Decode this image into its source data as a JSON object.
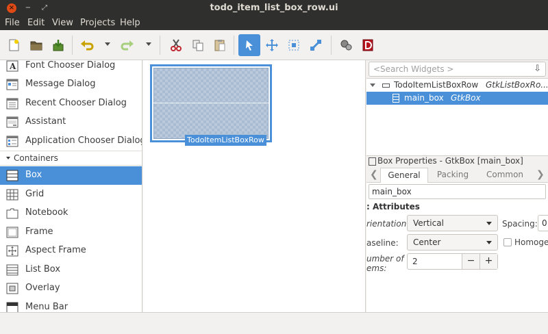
{
  "window": {
    "title": "todo_item_list_box_row.ui",
    "close_glyph": "×",
    "min_glyph": "−",
    "max_glyph": "⤢"
  },
  "menu": [
    "File",
    "Edit",
    "View",
    "Projects",
    "Help"
  ],
  "toolbar": {
    "icons": [
      "new-icon",
      "open-icon",
      "save-icon",
      "undo-icon",
      "redo-icon",
      "cut-icon",
      "copy-icon",
      "paste-icon",
      "select-icon",
      "drag-resize-icon",
      "margin-edit-icon",
      "align-edit-icon",
      "inspector-icon",
      "devhelp-icon"
    ],
    "active": "select-icon"
  },
  "palette": {
    "items_above": [
      {
        "label": "Font Chooser Dialog",
        "icon": "font-chooser-icon"
      },
      {
        "label": "Message Dialog",
        "icon": "message-dialog-icon"
      },
      {
        "label": "Recent Chooser Dialog",
        "icon": "recent-chooser-icon"
      },
      {
        "label": "Assistant",
        "icon": "assistant-icon"
      },
      {
        "label": "Application Chooser Dialog",
        "icon": "app-chooser-icon"
      }
    ],
    "section": "Containers",
    "items_below": [
      {
        "label": "Box",
        "icon": "box-icon",
        "selected": true
      },
      {
        "label": "Grid",
        "icon": "grid-icon"
      },
      {
        "label": "Notebook",
        "icon": "notebook-icon"
      },
      {
        "label": "Frame",
        "icon": "frame-icon"
      },
      {
        "label": "Aspect Frame",
        "icon": "aspect-frame-icon"
      },
      {
        "label": "List Box",
        "icon": "list-box-icon"
      },
      {
        "label": "Overlay",
        "icon": "overlay-icon"
      },
      {
        "label": "Menu Bar",
        "icon": "menu-bar-icon"
      }
    ]
  },
  "canvas": {
    "widget_label": "TodoItemListBoxRow"
  },
  "inspector": {
    "search_placeholder": "<Search Widgets >",
    "search_action_glyph": "⇩",
    "tree": [
      {
        "name": "TodoItemListBoxRow",
        "class": "GtkListBoxRo...",
        "selected": false
      },
      {
        "name": "main_box",
        "class": "GtkBox",
        "selected": true
      }
    ]
  },
  "properties": {
    "title": "Box Properties - GtkBox [main_box]",
    "tabs": [
      "General",
      "Packing",
      "Common"
    ],
    "active_tab": "General",
    "left_arrow": "❮",
    "right_arrow": "❯",
    "id_value": "main_box",
    "attributes_heading": ": Attributes",
    "orientation_label": "rientation:",
    "orientation_value": "Vertical",
    "spacing_label": "Spacing:",
    "spacing_value": "0",
    "baseline_label": "aseline:",
    "baseline_value": "Center",
    "homogeneous_label": "Homoge",
    "items_label_1": "umber of",
    "items_label_2": "ems:",
    "items_value": "2",
    "minus": "−",
    "plus": "+"
  },
  "colors": {
    "accent": "#4a90d9",
    "titlebar": "#2f2f2d",
    "close": "#df4a16"
  }
}
